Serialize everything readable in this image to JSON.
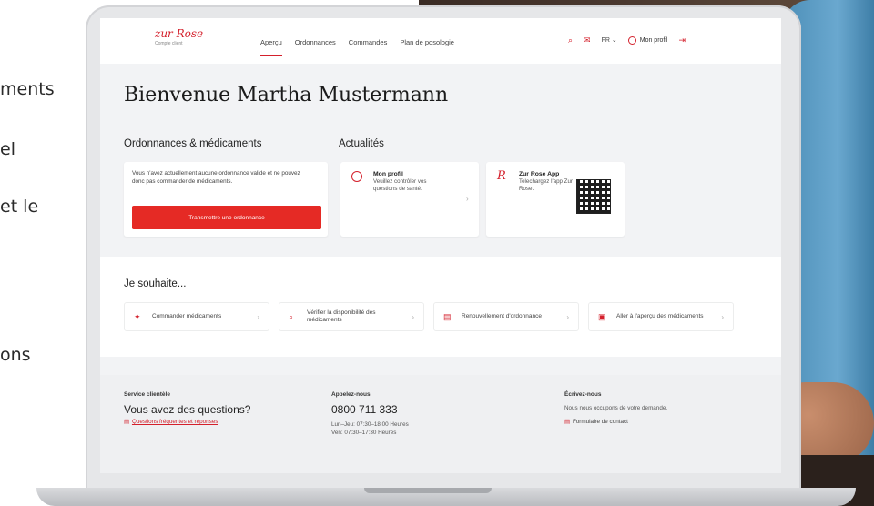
{
  "background": {
    "fragments": [
      "ments",
      "el",
      "et le",
      "ons"
    ]
  },
  "nav": {
    "logo_brand": "zur Rose",
    "logo_sub": "Compte client",
    "links": [
      "Aperçu",
      "Ordonnances",
      "Commandes",
      "Plan de posologie"
    ],
    "lang": "FR ⌄",
    "profile": "Mon profil"
  },
  "welcome": "Bienvenue Martha Mustermann",
  "ordonnances": {
    "heading": "Ordonnances & médicaments",
    "message": "Vous n'avez actuellement aucune ordonnance valide et ne pouvez donc pas commander de médicaments.",
    "button": "Transmettre une ordonnance"
  },
  "actualites": {
    "heading": "Actualités",
    "cards": [
      {
        "title": "Mon profil",
        "text": "Veuillez contrôler vos questions de santé."
      },
      {
        "title": "Zur Rose App",
        "text": "Telechargez l'app Zur Rose."
      }
    ]
  },
  "souhaite": {
    "heading": "Je souhaite...",
    "actions": [
      "Commander médicaments",
      "Vérifier la disponibilité des médicaments",
      "Renouvellement d'ordonnance",
      "Aller à l'aperçu des médicaments"
    ]
  },
  "footer": {
    "service": {
      "label": "Service clientèle",
      "big": "Vous avez des questions?",
      "link": "Questions fréquentes et réponses"
    },
    "appelez": {
      "label": "Appelez-nous",
      "phone": "0800 711 333",
      "hours1": "Lun–Jeu: 07:30–18:00 Heures",
      "hours2": "Ven: 07:30–17:30 Heures"
    },
    "ecrivez": {
      "label": "Écrivez-nous",
      "text": "Nous nous occupons de votre demande.",
      "link": "Formulaire de contact"
    }
  }
}
